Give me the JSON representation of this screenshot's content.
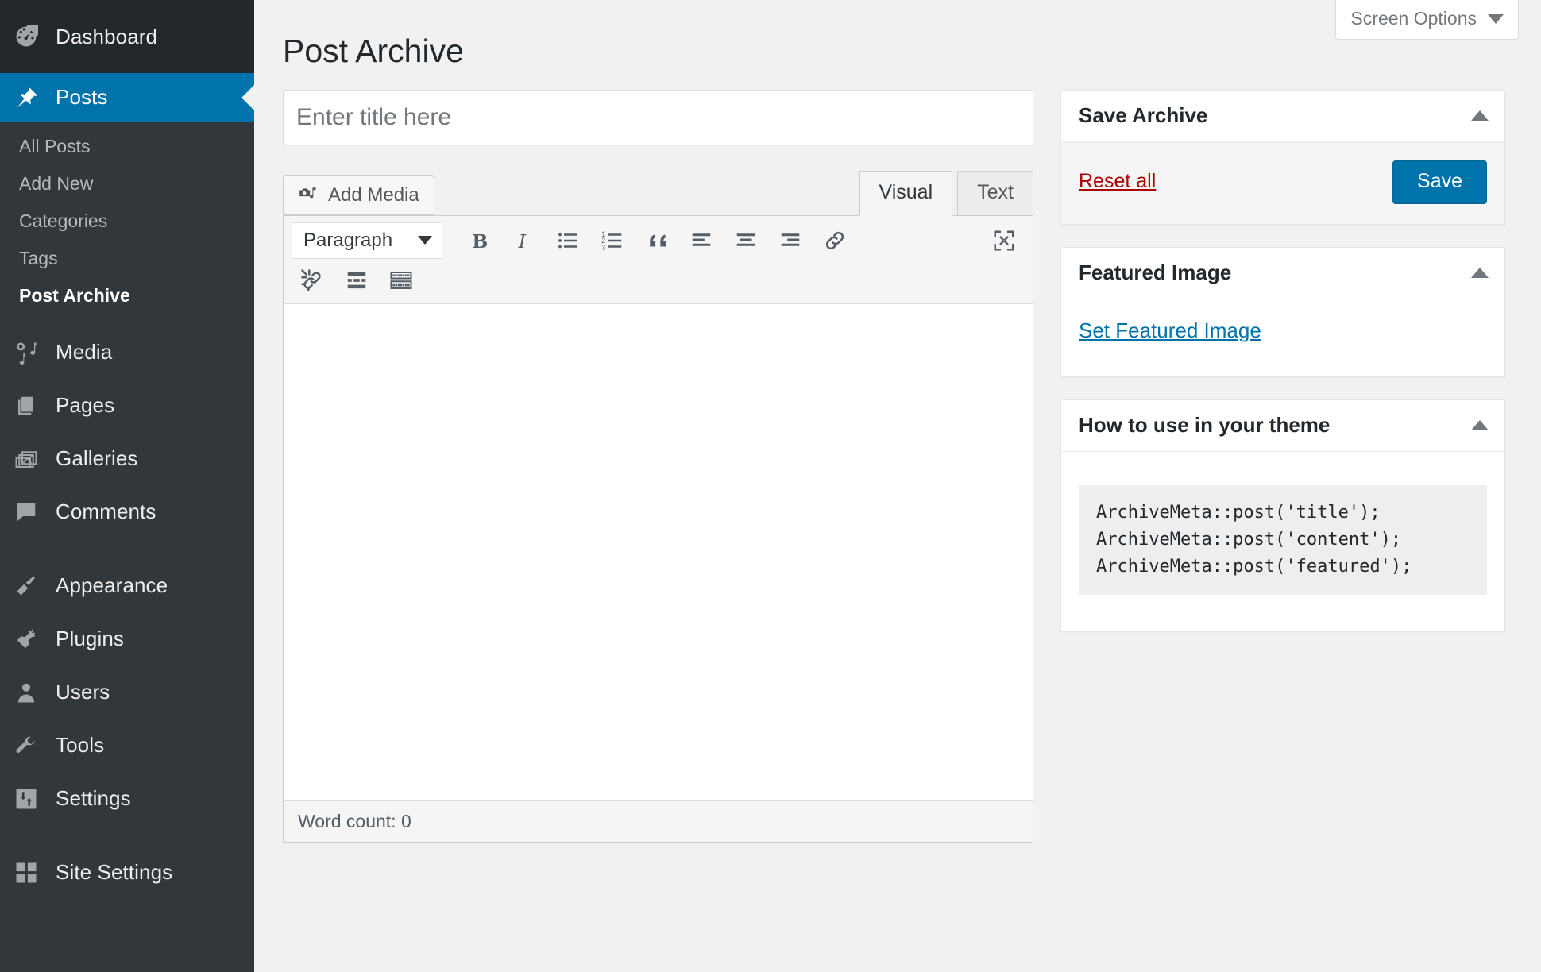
{
  "sidebar": {
    "dashboard": {
      "label": "Dashboard",
      "icon": "dashboard-icon"
    },
    "posts": {
      "label": "Posts",
      "icon": "pin-icon"
    },
    "posts_submenu": [
      {
        "label": "All Posts",
        "active": false
      },
      {
        "label": "Add New",
        "active": false
      },
      {
        "label": "Categories",
        "active": false
      },
      {
        "label": "Tags",
        "active": false
      },
      {
        "label": "Post Archive",
        "active": true
      }
    ],
    "items": [
      {
        "label": "Media",
        "icon": "media-icon"
      },
      {
        "label": "Pages",
        "icon": "pages-icon"
      },
      {
        "label": "Galleries",
        "icon": "galleries-icon"
      },
      {
        "label": "Comments",
        "icon": "comment-icon"
      },
      {
        "label": "Appearance",
        "icon": "brush-icon"
      },
      {
        "label": "Plugins",
        "icon": "plug-icon"
      },
      {
        "label": "Users",
        "icon": "user-icon"
      },
      {
        "label": "Tools",
        "icon": "wrench-icon"
      },
      {
        "label": "Settings",
        "icon": "sliders-icon"
      },
      {
        "label": "Site Settings",
        "icon": "grid-icon"
      }
    ]
  },
  "header": {
    "screen_options_label": "Screen Options",
    "page_title": "Post Archive"
  },
  "editor": {
    "title_placeholder": "Enter title here",
    "title_value": "",
    "add_media_label": "Add Media",
    "tabs": [
      {
        "label": "Visual",
        "active": true
      },
      {
        "label": "Text",
        "active": false
      }
    ],
    "format_select_value": "Paragraph",
    "toolbar_row1": [
      {
        "name": "bold-icon",
        "title": "Bold"
      },
      {
        "name": "italic-icon",
        "title": "Italic"
      },
      {
        "name": "bulleted-list-icon",
        "title": "Bulleted list"
      },
      {
        "name": "numbered-list-icon",
        "title": "Numbered list"
      },
      {
        "name": "blockquote-icon",
        "title": "Blockquote"
      },
      {
        "name": "align-left-icon",
        "title": "Align left"
      },
      {
        "name": "align-center-icon",
        "title": "Align center"
      },
      {
        "name": "align-right-icon",
        "title": "Align right"
      },
      {
        "name": "link-icon",
        "title": "Insert/edit link"
      },
      {
        "name": "fullscreen-icon",
        "title": "Distraction-free writing mode"
      }
    ],
    "toolbar_row2": [
      {
        "name": "unlink-icon",
        "title": "Remove link"
      },
      {
        "name": "read-more-icon",
        "title": "Insert Read More tag"
      },
      {
        "name": "keyboard-icon",
        "title": "Toolbar Toggle"
      }
    ],
    "body_value": "",
    "word_count_label": "Word count: 0"
  },
  "panels": {
    "save_archive": {
      "title": "Save Archive",
      "reset_label": "Reset all",
      "save_label": "Save"
    },
    "featured_image": {
      "title": "Featured Image",
      "set_label": "Set Featured Image"
    },
    "how_to_use": {
      "title": "How to use in your theme",
      "code": "ArchiveMeta::post('title');\nArchiveMeta::post('content');\nArchiveMeta::post('featured');"
    }
  },
  "colors": {
    "accent_blue": "#0073aa",
    "sidebar_bg": "#32373c",
    "sidebar_top_bg": "#23282d",
    "link_red": "#a00",
    "page_bg": "#f1f1f1"
  }
}
